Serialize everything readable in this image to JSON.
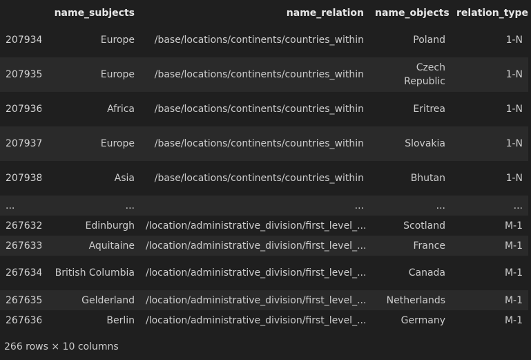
{
  "table": {
    "columns": [
      "",
      "name_subjects",
      "name_relation",
      "name_objects",
      "relation_type"
    ],
    "rows": [
      {
        "index": "207934",
        "name_subjects": "Europe",
        "name_relation": "/base/locations/continents/countries_within",
        "name_objects": "Poland",
        "relation_type": "1-N"
      },
      {
        "index": "207935",
        "name_subjects": "Europe",
        "name_relation": "/base/locations/continents/countries_within",
        "name_objects": "Czech Republic",
        "relation_type": "1-N"
      },
      {
        "index": "207936",
        "name_subjects": "Africa",
        "name_relation": "/base/locations/continents/countries_within",
        "name_objects": "Eritrea",
        "relation_type": "1-N"
      },
      {
        "index": "207937",
        "name_subjects": "Europe",
        "name_relation": "/base/locations/continents/countries_within",
        "name_objects": "Slovakia",
        "relation_type": "1-N"
      },
      {
        "index": "207938",
        "name_subjects": "Asia",
        "name_relation": "/base/locations/continents/countries_within",
        "name_objects": "Bhutan",
        "relation_type": "1-N"
      },
      {
        "index": "...",
        "name_subjects": "...",
        "name_relation": "...",
        "name_objects": "...",
        "relation_type": "..."
      },
      {
        "index": "267632",
        "name_subjects": "Edinburgh",
        "name_relation": "/location/administrative_division/first_level_...",
        "name_objects": "Scotland",
        "relation_type": "M-1"
      },
      {
        "index": "267633",
        "name_subjects": "Aquitaine",
        "name_relation": "/location/administrative_division/first_level_...",
        "name_objects": "France",
        "relation_type": "M-1"
      },
      {
        "index": "267634",
        "name_subjects": "British Columbia",
        "name_relation": "/location/administrative_division/first_level_...",
        "name_objects": "Canada",
        "relation_type": "M-1"
      },
      {
        "index": "267635",
        "name_subjects": "Gelderland",
        "name_relation": "/location/administrative_division/first_level_...",
        "name_objects": "Netherlands",
        "relation_type": "M-1"
      },
      {
        "index": "267636",
        "name_subjects": "Berlin",
        "name_relation": "/location/administrative_division/first_level_...",
        "name_objects": "Germany",
        "relation_type": "M-1"
      }
    ]
  },
  "footer": "266 rows × 10 columns"
}
